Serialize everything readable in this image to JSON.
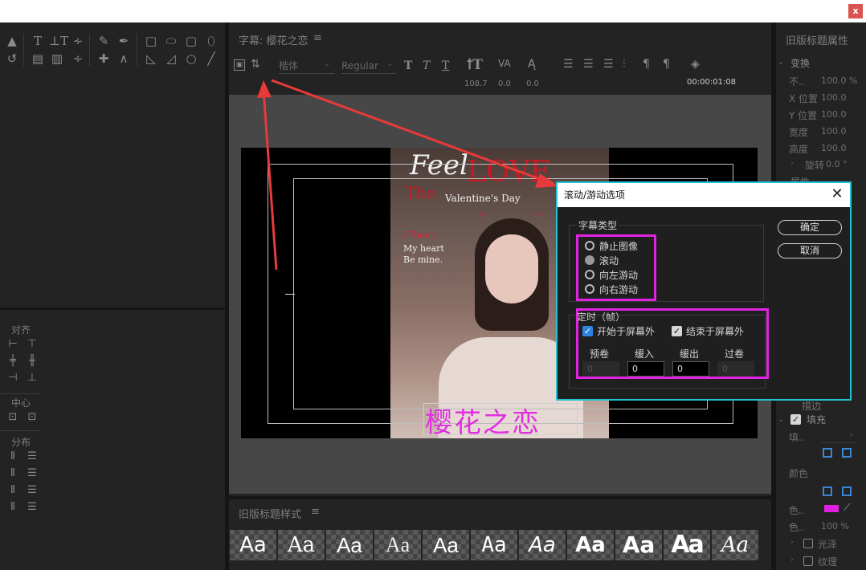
{
  "window": {
    "close_glyph": "x"
  },
  "titler": {
    "title": "字幕: 樱花之恋",
    "menu_glyph": "≡",
    "font_family": "楷体",
    "font_style": "Regular",
    "font_size": "108.7",
    "kerning": "0.0",
    "baseline": "0.0",
    "timecode": "00:00:01:08",
    "subtitle_text": "樱花之恋"
  },
  "poster": {
    "line1": "Feel",
    "line2": "The",
    "line3": "LOVE",
    "line4": "Valentine's Day",
    "take": "/ Take /",
    "heart1": "My heart",
    "heart2": "Be mine."
  },
  "align_panel": {
    "title_align": "对齐",
    "title_center": "中心",
    "title_distribute": "分布"
  },
  "styles_panel": {
    "title": "旧版标题样式",
    "menu_glyph": "≡",
    "sample": "Aa"
  },
  "properties_panel": {
    "title": "旧版标题属性",
    "transform": "变换",
    "opacity_label": "不..",
    "opacity_value": "100.0 %",
    "x_label": "X 位置",
    "x_value": "100.0",
    "y_label": "Y 位置",
    "y_value": "100.0",
    "w_label": "宽度",
    "w_value": "100.0",
    "h_label": "高度",
    "h_value": "100.0",
    "rot_label": "旋转",
    "rot_value": "0.0 °",
    "attr_label": "属性",
    "fill_label": "填充",
    "fill_type_label": "填..",
    "color_label": "颜色",
    "color_item": "色..",
    "opacity2_label": "色..",
    "opacity2_value": "100 %",
    "gloss": "光泽",
    "texture": "纹理",
    "cut_label": "描边",
    "fill_color": "#e020e0"
  },
  "dialog": {
    "title": "滚动/游动选项",
    "close_glyph": "✕",
    "type_group": "字幕类型",
    "opt_still": "静止图像",
    "opt_roll": "滚动",
    "opt_crawl_left": "向左游动",
    "opt_crawl_right": "向右游动",
    "timing_group": "定时（帧）",
    "start_off": "开始于屏幕外",
    "end_off": "结束于屏幕外",
    "preroll": "预卷",
    "ease_in": "缓入",
    "ease_out": "缓出",
    "postroll": "过卷",
    "preroll_val": "0",
    "ease_in_val": "0",
    "ease_out_val": "0",
    "postroll_val": "0",
    "ok": "确定",
    "cancel": "取消"
  }
}
